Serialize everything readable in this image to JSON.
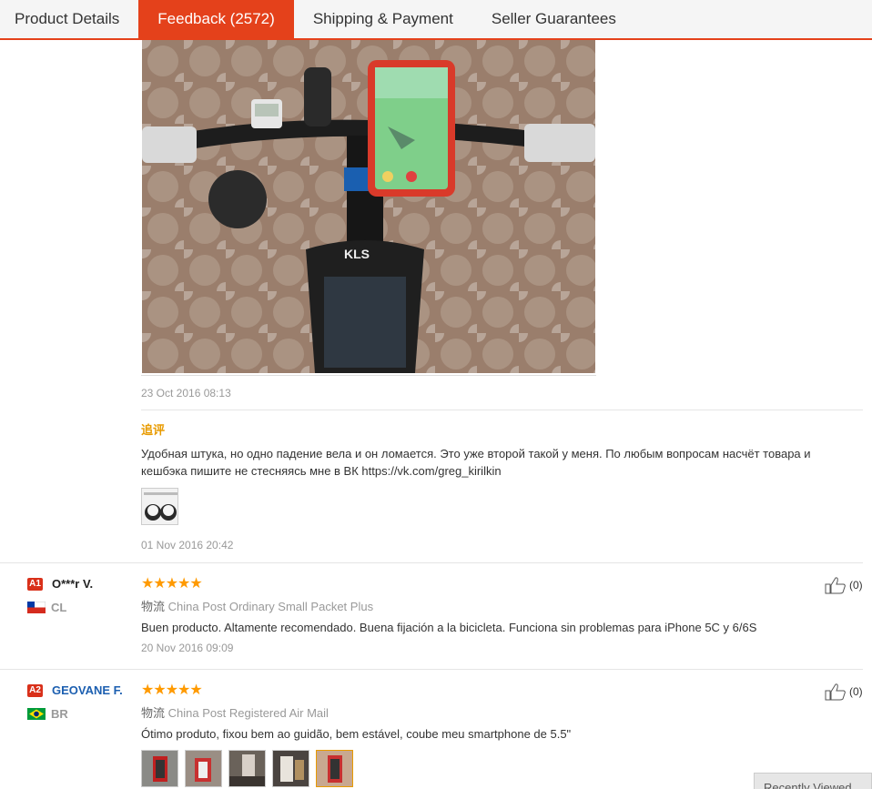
{
  "tabs": [
    {
      "label": "Product Details"
    },
    {
      "label": "Feedback (2572)"
    },
    {
      "label": "Shipping & Payment"
    },
    {
      "label": "Seller Guarantees"
    }
  ],
  "review0": {
    "date": "23 Oct 2016 08:13",
    "additional_title": "追评",
    "additional_text_line1": "Удобная штука, но одно падение вела и он ломается. Это уже второй такой у меня. По любым вопросам насчёт товара и",
    "additional_text_line2": "кешбэка пишите не стесняясь мне в ВК https://vk.com/greg_kirilkin",
    "additional_date": "01 Nov 2016 20:42"
  },
  "reviews": [
    {
      "badge": "A1",
      "name": "O***r V.",
      "country": "CL",
      "stars": "★★★★★",
      "logistics_label": "物流",
      "logistics": "China Post Ordinary Small Packet Plus",
      "text": "Buen producto. Altamente recomendado. Buena fijación a la bicicleta. Funciona sin problemas para iPhone 5C y 6/6S",
      "date": "20 Nov 2016 09:09",
      "helpful": "(0)"
    },
    {
      "badge": "A2",
      "name": "GEOVANE F.",
      "country": "BR",
      "stars": "★★★★★",
      "logistics_label": "物流",
      "logistics": "China Post Registered Air Mail",
      "text": "Ótimo produto, fixou bem ao guidão, bem estável, coube meu smartphone de 5.5\"",
      "helpful": "(0)"
    }
  ],
  "recently_viewed": "Recently Viewed",
  "colors": {
    "accent": "#e4411b",
    "star": "#ff9a00",
    "name_blue": "#1c5fb0",
    "additional": "#e89b00"
  }
}
